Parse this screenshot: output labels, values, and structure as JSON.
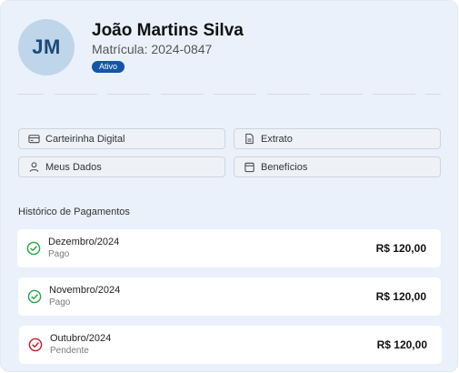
{
  "profile": {
    "initials": "JM",
    "name": "João Martins Silva",
    "registration": "Matrícula: 2024-0847",
    "status": "Ativo"
  },
  "actions": [
    {
      "label": "Carteirinha Digital",
      "icon": "card-icon"
    },
    {
      "label": "Extrato",
      "icon": "document-icon"
    },
    {
      "label": "Meus Dados",
      "icon": "user-icon"
    },
    {
      "label": "Benefícios",
      "icon": "calendar-icon"
    }
  ],
  "history": {
    "title": "Histórico de Pagamentos",
    "payments": [
      {
        "month": "Dezembro/2024",
        "status": "Pago",
        "amount": "R$ 120,00",
        "state": "paid"
      },
      {
        "month": "Novembro/2024",
        "status": "Pago",
        "amount": "R$ 120,00",
        "state": "paid"
      },
      {
        "month": "Outubro/2024",
        "status": "Pendente",
        "amount": "R$ 120,00",
        "state": "pending"
      }
    ]
  },
  "colors": {
    "background": "#eaf1fb",
    "accent": "#1456a6",
    "paid": "#22a447",
    "pending": "#c0182b"
  }
}
